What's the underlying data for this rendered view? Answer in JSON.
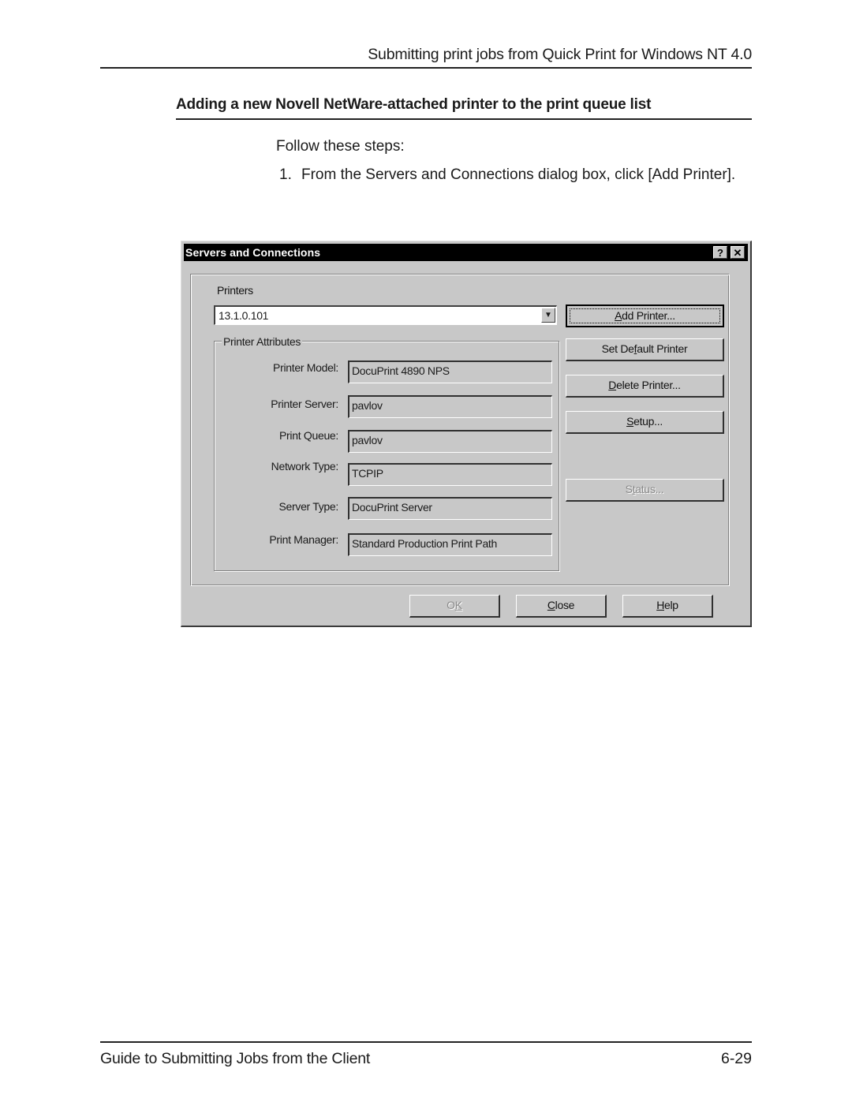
{
  "page": {
    "running_head": "Submitting print jobs from Quick Print for Windows NT 4.0",
    "section_heading": "Adding a new Novell NetWare-attached printer to the print queue list",
    "intro": "Follow these steps:",
    "steps": [
      {
        "number": "1.",
        "text": "From the Servers and Connections dialog box, click [Add Printer]."
      }
    ],
    "footer_title": "Guide to Submitting Jobs from the Client",
    "page_number": "6-29"
  },
  "dialog": {
    "title": "Servers and Connections",
    "help_icon": "?",
    "close_icon": "✕",
    "printers_label": "Printers",
    "printers_selected": "13.1.0.101",
    "dropdown_icon": "▼",
    "group_label": "Printer Attributes",
    "attributes": [
      {
        "label": "Printer Model:",
        "value": "DocuPrint 4890 NPS"
      },
      {
        "label": "Printer Server:",
        "value": "pavlov"
      },
      {
        "label": "Print Queue:",
        "value": "pavlov"
      },
      {
        "label": "Network Type:",
        "value": "TCPIP"
      },
      {
        "label": "Server Type:",
        "value": "DocuPrint Server"
      },
      {
        "label": "Print Manager:",
        "value": "Standard Production Print Path"
      }
    ],
    "side_buttons": {
      "add_printer": {
        "pre": "",
        "key": "A",
        "post": "dd Printer..."
      },
      "set_default": {
        "pre": "Set De",
        "key": "f",
        "post": "ault Printer"
      },
      "delete_printer": {
        "pre": "",
        "key": "D",
        "post": "elete Printer..."
      },
      "setup": {
        "pre": "",
        "key": "S",
        "post": "etup..."
      },
      "status": {
        "pre": "S",
        "key": "t",
        "post": "atus..."
      }
    },
    "bottom_buttons": {
      "ok": {
        "pre": "O",
        "key": "K",
        "post": ""
      },
      "close": {
        "pre": "",
        "key": "C",
        "post": "lose"
      },
      "help": {
        "pre": "",
        "key": "H",
        "post": "elp"
      }
    }
  }
}
